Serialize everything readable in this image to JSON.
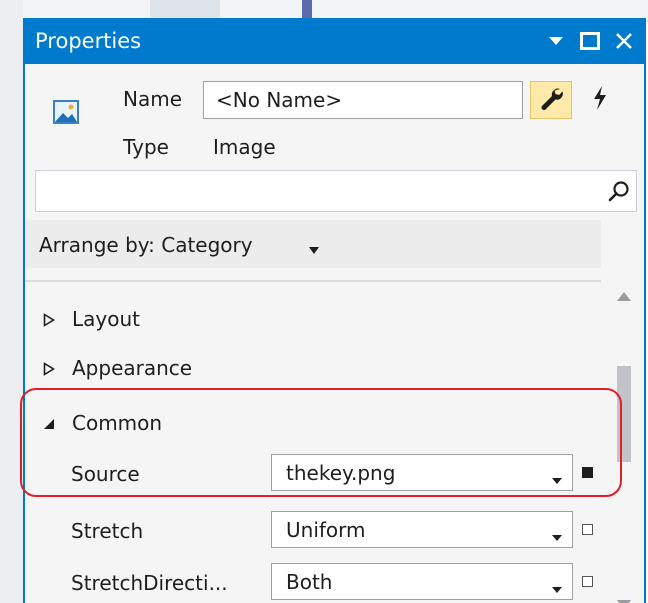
{
  "window": {
    "title": "Properties",
    "controls": [
      {
        "icon": "dropdown-arrow-icon"
      },
      {
        "icon": "maximize-icon"
      },
      {
        "icon": "close-icon"
      }
    ]
  },
  "header": {
    "element_icon": "image-icon",
    "name_label": "Name",
    "name_value": "<No Name>",
    "properties_button_icon": "wrench-icon",
    "events_button_icon": "lightning-bolt-icon",
    "type_label": "Type",
    "type_value": "Image"
  },
  "search": {
    "value": "",
    "placeholder": "",
    "icon": "search-icon"
  },
  "arrange_by": {
    "label": "Arrange by: Category"
  },
  "categories": [
    {
      "label": "Layout",
      "expanded": false
    },
    {
      "label": "Appearance",
      "expanded": false
    },
    {
      "label": "Common",
      "expanded": true
    }
  ],
  "properties": [
    {
      "name": "Source",
      "value": "thekey.png",
      "marker": "filled"
    },
    {
      "name": "Stretch",
      "value": "Uniform",
      "marker": "empty"
    },
    {
      "name": "StretchDirecti...",
      "value": "Both",
      "marker": "empty"
    }
  ],
  "colors": {
    "accent": "#007acc",
    "highlight": "#e01f2a",
    "active_button": "#fde9a8"
  }
}
